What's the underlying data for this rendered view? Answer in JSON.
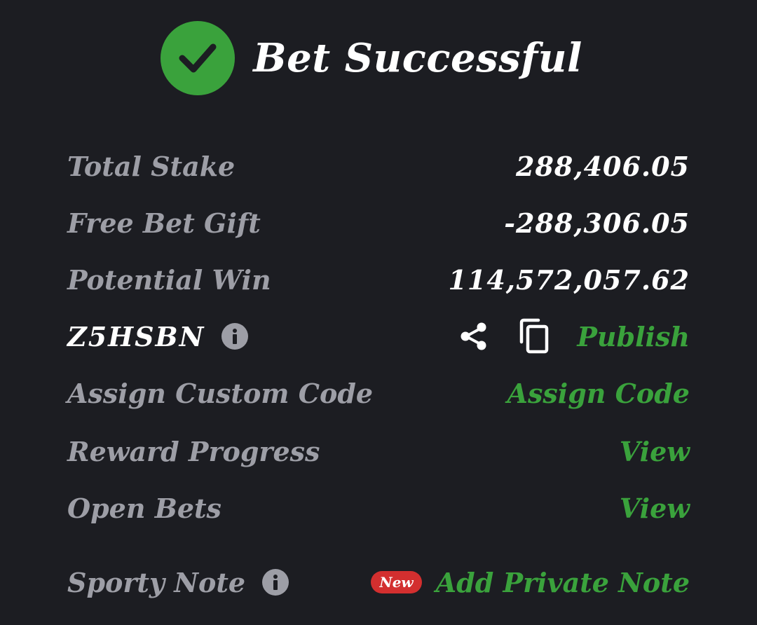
{
  "header": {
    "title": "Bet Successful",
    "status_icon": "check-icon"
  },
  "rows": {
    "total_stake": {
      "label": "Total Stake",
      "value": "288,406.05"
    },
    "free_bet_gift": {
      "label": "Free Bet Gift",
      "value": "-288,306.05"
    },
    "potential_win": {
      "label": "Potential Win",
      "value": "114,572,057.62"
    },
    "booking": {
      "code": "Z5HSBN",
      "info_icon": "info-icon",
      "share_icon": "share-icon",
      "copy_icon": "copy-icon",
      "publish_label": "Publish"
    },
    "custom_code": {
      "label": "Assign Custom Code",
      "action": "Assign Code"
    },
    "reward_progress": {
      "label": "Reward Progress",
      "action": "View"
    },
    "open_bets": {
      "label": "Open Bets",
      "action": "View"
    },
    "sporty_note": {
      "label": "Sporty Note",
      "info_icon": "info-icon",
      "badge": "New",
      "action": "Add Private Note"
    }
  },
  "colors": {
    "background": "#1c1d22",
    "accent_green": "#3aa23c",
    "label_grey": "#9d9ea6",
    "badge_red": "#d32f2f"
  }
}
